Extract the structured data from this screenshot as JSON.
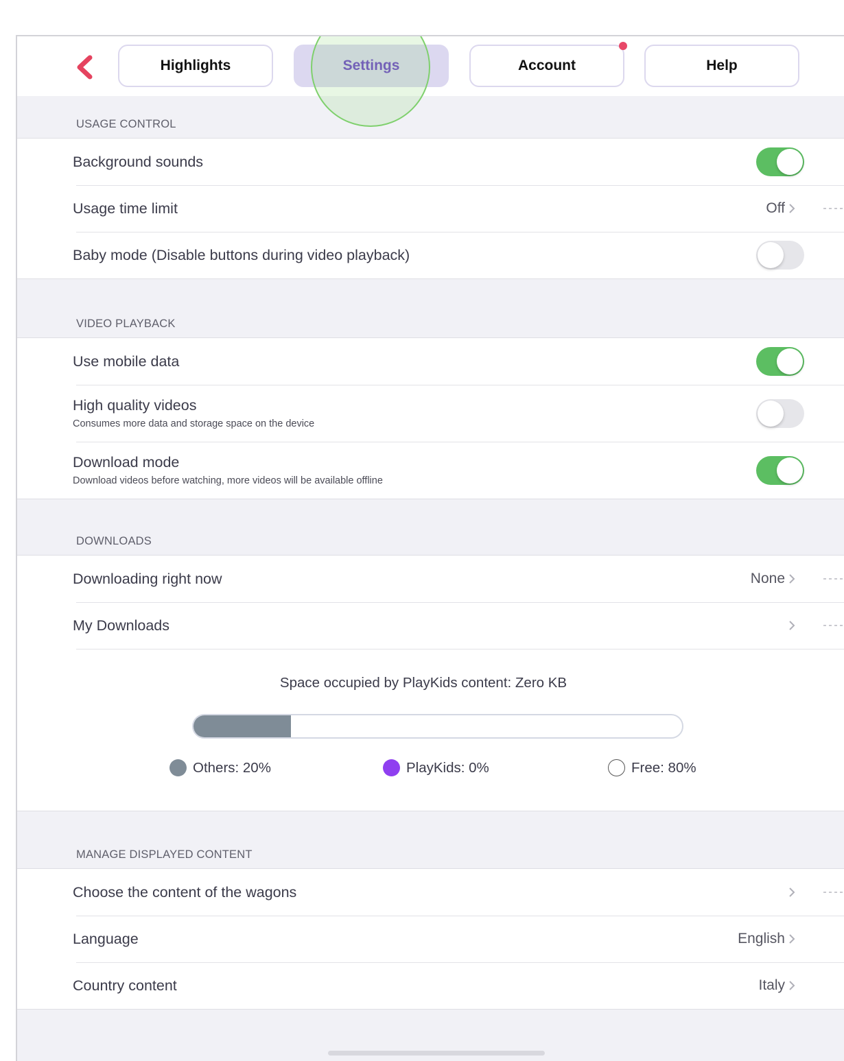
{
  "tabs": [
    {
      "label": "Highlights",
      "active": false,
      "notification": false
    },
    {
      "label": "Settings",
      "active": true,
      "notification": false
    },
    {
      "label": "Account",
      "active": false,
      "notification": true
    },
    {
      "label": "Help",
      "active": false,
      "notification": false
    }
  ],
  "sections": {
    "usage": {
      "title": "USAGE CONTROL",
      "background_sounds": {
        "label": "Background sounds",
        "on": true
      },
      "usage_time_limit": {
        "label": "Usage time limit",
        "value": "Off"
      },
      "baby_mode": {
        "label": "Baby mode (Disable buttons during video playback)",
        "on": false
      }
    },
    "video": {
      "title": "VIDEO PLAYBACK",
      "mobile_data": {
        "label": "Use mobile data",
        "on": true
      },
      "high_quality": {
        "label": "High quality videos",
        "sub": "Consumes more data and storage space on the device",
        "on": false
      },
      "download_mode": {
        "label": "Download mode",
        "sub": "Download videos before watching, more videos will be available offline",
        "on": true
      }
    },
    "downloads": {
      "title": "DOWNLOADS",
      "downloading_now": {
        "label": "Downloading right now",
        "value": "None"
      },
      "my_downloads": {
        "label": "My Downloads"
      },
      "storage": {
        "text": "Space occupied by PlayKids content: Zero KB",
        "others": {
          "label": "Others: 20%",
          "percent": 20,
          "color": "#7f8c97"
        },
        "playkids": {
          "label": "PlayKids: 0%",
          "percent": 0,
          "color": "#8f3ff0"
        },
        "free": {
          "label": "Free: 80%",
          "percent": 80
        }
      }
    },
    "content": {
      "title": "MANAGE DISPLAYED CONTENT",
      "wagons": {
        "label": "Choose the content of the wagons"
      },
      "language": {
        "label": "Language",
        "value": "English"
      },
      "country": {
        "label": "Country content",
        "value": "Italy"
      }
    }
  },
  "colors": {
    "accent": "#6a3fc6",
    "toggle_on": "#5cbe62",
    "back_arrow": "#e5435f"
  }
}
